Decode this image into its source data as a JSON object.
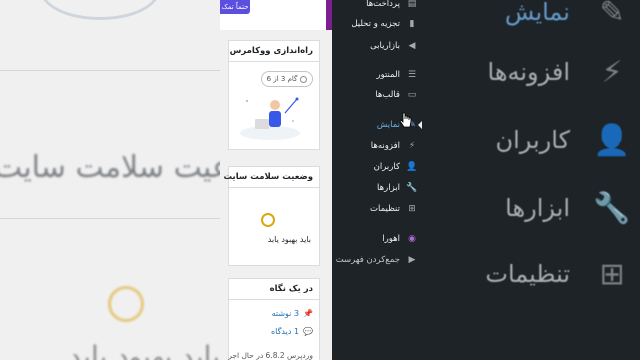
{
  "background_left": {
    "button_label": "حتماً تمک",
    "big_title": "عیت سلامت سایت",
    "big_status": "باید بهبود یابد"
  },
  "banner": {
    "button_label": "حتماً تمک"
  },
  "panels": {
    "woocommerce_setup": {
      "title": "راه‌اندازی ووکامرس",
      "steps": "گام 3 از 6"
    },
    "site_health": {
      "title": "وضعیت سلامت سایت",
      "status": "باید بهبود یابد"
    },
    "at_a_glance": {
      "title": "در یک نگاه",
      "posts": "3 نوشته",
      "comments": "1 دیدگاه",
      "footer": "وردپرس 6.8.2 در حال اجر"
    }
  },
  "sidebar": {
    "items": [
      {
        "label": "پرداخت‌ها",
        "icon": "payments-icon"
      },
      {
        "label": "تجزیه و تحلیل",
        "icon": "analytics-icon"
      },
      {
        "label": "بازاریابی",
        "icon": "marketing-icon"
      },
      {
        "label": "المنتور",
        "icon": "elementor-icon"
      },
      {
        "label": "قالب‌ها",
        "icon": "templates-icon"
      },
      {
        "label": "نمایش",
        "icon": "appearance-icon"
      },
      {
        "label": "افزونه‌ها",
        "icon": "plugins-icon"
      },
      {
        "label": "کاربران",
        "icon": "users-icon"
      },
      {
        "label": "ابزارها",
        "icon": "tools-icon"
      },
      {
        "label": "تنظیمات",
        "icon": "settings-icon"
      },
      {
        "label": "اهورا",
        "icon": "ahura-icon"
      },
      {
        "label": "جمع‌کردن فهرست",
        "icon": "collapse-icon"
      }
    ]
  },
  "background_right": {
    "items": [
      "نمایش",
      "افزونه‌ها",
      "کاربران",
      "ابزارها",
      "تنظیمات"
    ]
  }
}
